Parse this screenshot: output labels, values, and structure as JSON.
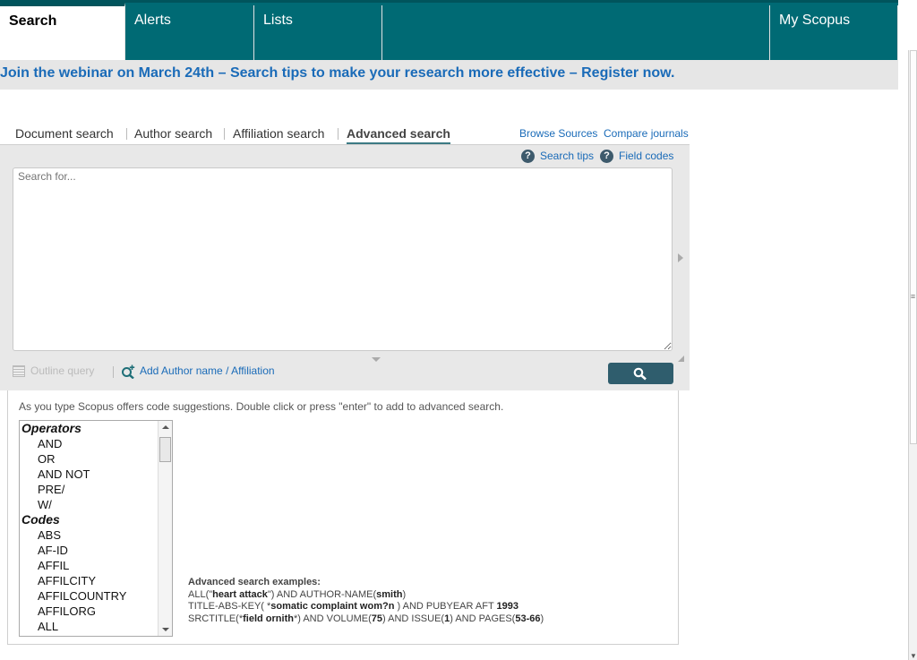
{
  "nav": {
    "tabs": [
      {
        "label": "Search"
      },
      {
        "label": "Alerts"
      },
      {
        "label": "Lists"
      },
      {
        "label": "My Scopus"
      }
    ]
  },
  "banner": {
    "text": "Join the webinar on March 24th – Search tips to make your research more effective – Register now."
  },
  "search_types": {
    "tabs": [
      {
        "label": "Document search"
      },
      {
        "label": "Author search"
      },
      {
        "label": "Affiliation search"
      },
      {
        "label": "Advanced search",
        "active": true
      }
    ],
    "links": {
      "browse_sources": "Browse Sources",
      "compare_journals": "Compare journals"
    }
  },
  "help": {
    "search_tips": "Search tips",
    "field_codes": "Field codes"
  },
  "query": {
    "value": "",
    "placeholder": "Search for..."
  },
  "tools": {
    "outline_query": "Outline query",
    "add_author": "Add Author name / Affiliation"
  },
  "suggestions": {
    "hint": "As you type Scopus offers code suggestions. Double click or press \"enter\" to add to advanced search.",
    "operators_label": "Operators",
    "operators": [
      "AND",
      "OR",
      "AND NOT",
      "PRE/",
      "W/"
    ],
    "codes_label": "Codes",
    "codes": [
      "ABS",
      "AF-ID",
      "AFFIL",
      "AFFILCITY",
      "AFFILCOUNTRY",
      "AFFILORG",
      "ALL"
    ]
  },
  "examples": {
    "title": "Advanced search examples:",
    "lines": [
      [
        {
          "t": "ALL(\"",
          "b": false
        },
        {
          "t": "heart attack",
          "b": true
        },
        {
          "t": "\") AND AUTHOR-NAME(",
          "b": false
        },
        {
          "t": "smith",
          "b": true
        },
        {
          "t": ")",
          "b": false
        }
      ],
      [
        {
          "t": "TITLE-ABS-KEY( *",
          "b": false
        },
        {
          "t": "somatic complaint wom?n",
          "b": true
        },
        {
          "t": " ) AND PUBYEAR AFT ",
          "b": false
        },
        {
          "t": "1993",
          "b": true
        }
      ],
      [
        {
          "t": "SRCTITLE(*",
          "b": false
        },
        {
          "t": "field ornith",
          "b": true
        },
        {
          "t": "*) AND VOLUME(",
          "b": false
        },
        {
          "t": "75",
          "b": true
        },
        {
          "t": ") AND ISSUE(",
          "b": false
        },
        {
          "t": "1",
          "b": true
        },
        {
          "t": ") AND PAGES(",
          "b": false
        },
        {
          "t": "53-66",
          "b": true
        },
        {
          "t": ")",
          "b": false
        }
      ]
    ]
  },
  "colors": {
    "nav_bg": "#006a74",
    "link": "#1a6bb8",
    "button": "#2f5d6d"
  }
}
